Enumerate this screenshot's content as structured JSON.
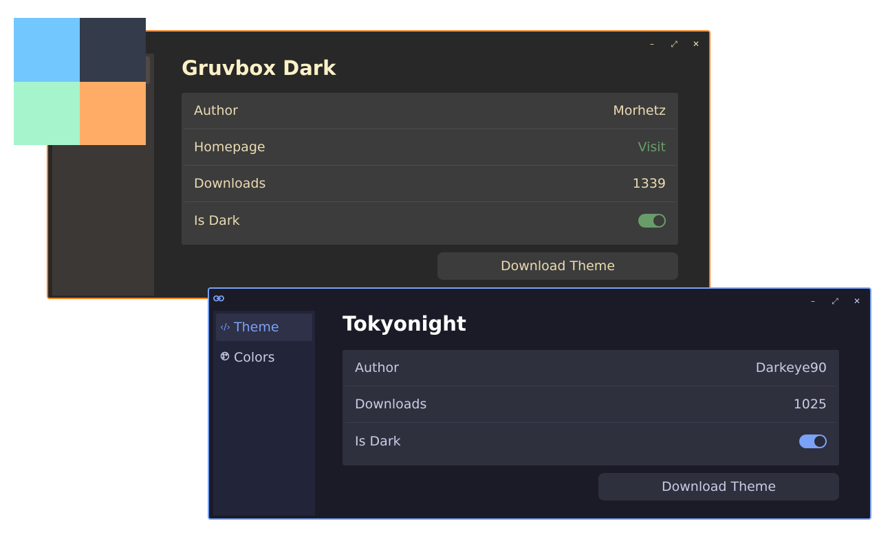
{
  "palette": {
    "colors": [
      "#73c7ff",
      "#343b4a",
      "#a6f4cc",
      "#ffad66"
    ]
  },
  "gruvbox": {
    "border_color": "#fe8019",
    "title": "Gruvbox Dark",
    "window_controls": {
      "minimize": "–",
      "maximize": "⤢",
      "close": "✕"
    },
    "rows": [
      {
        "label": "Author",
        "value": "Morhetz"
      },
      {
        "label": "Homepage",
        "value": "Visit"
      },
      {
        "label": "Downloads",
        "value": "1339"
      },
      {
        "label": "Is Dark",
        "toggle": "on"
      }
    ],
    "download_label": "Download Theme"
  },
  "tokyonight": {
    "border_color": "#7aa2f7",
    "title": "Tokyonight",
    "window_controls": {
      "minimize": "–",
      "maximize": "⤢",
      "close": "✕"
    },
    "titlebar_icon": "link-icon",
    "sidebar": {
      "items": [
        {
          "label": "Theme",
          "icon": "code-icon",
          "active": true
        },
        {
          "label": "Colors",
          "icon": "palette-icon",
          "active": false
        }
      ]
    },
    "rows": [
      {
        "label": "Author",
        "value": "Darkeye90"
      },
      {
        "label": "Downloads",
        "value": "1025"
      },
      {
        "label": "Is Dark",
        "toggle": "on"
      }
    ],
    "download_label": "Download Theme"
  }
}
